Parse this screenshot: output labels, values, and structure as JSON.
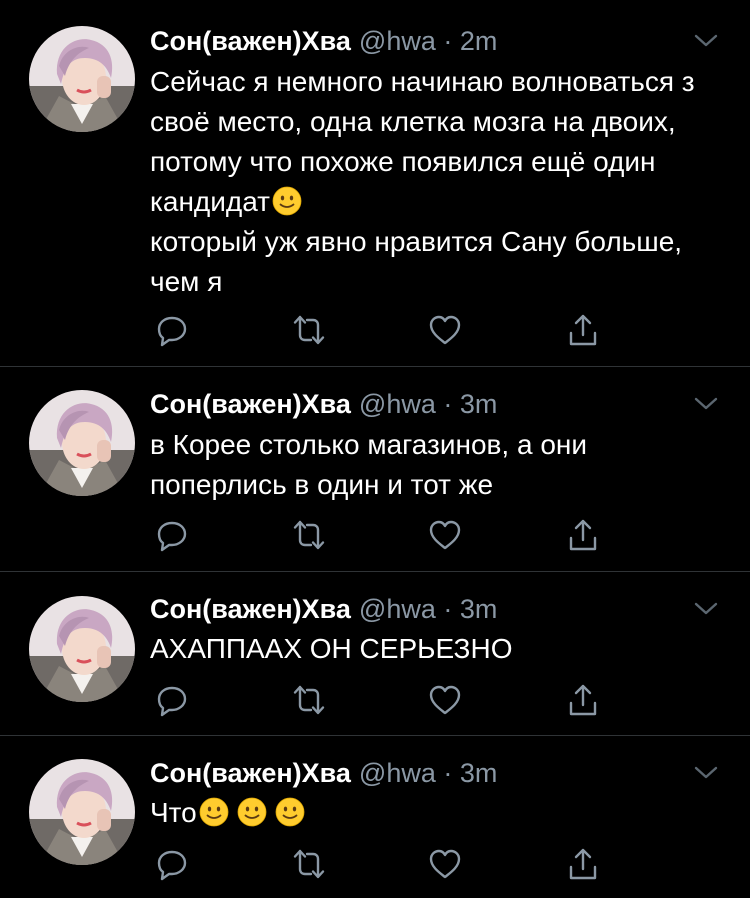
{
  "theme": {
    "background": "#000000",
    "text": "#ffffff",
    "secondary": "#8b98a5",
    "divider": "#2f3336",
    "emoji": "#ffcc2e"
  },
  "tweets": [
    {
      "name": "Сон(важен)Хва",
      "handle": "@hwa",
      "separator": "·",
      "time": "2m",
      "text_line1": "Сейчас я немного начинаю волноваться з своё место, одна клетка мозга на двоих, потому что похоже появился ещё один кандидат",
      "text_line2": "который уж явно нравится Сану больше, чем я",
      "emoji": "slightly-smiling-face"
    },
    {
      "name": "Сон(важен)Хва",
      "handle": "@hwa",
      "separator": "·",
      "time": "3m",
      "text": "в Корее столько магазинов, а они поперлись в один и тот же"
    },
    {
      "name": "Сон(важен)Хва",
      "handle": "@hwa",
      "separator": "·",
      "time": "3m",
      "text": "АХАППААХ ОН СЕРЬЕЗНО"
    },
    {
      "name": "Сон(важен)Хва",
      "handle": "@hwa",
      "separator": "·",
      "time": "3m",
      "text": "Что",
      "emoji": "slightly-smiling-face",
      "emoji_count": 3
    }
  ],
  "icons": {
    "reply": "reply-icon",
    "retweet": "retweet-icon",
    "like": "like-icon",
    "share": "share-icon",
    "more": "chevron-down-icon"
  }
}
